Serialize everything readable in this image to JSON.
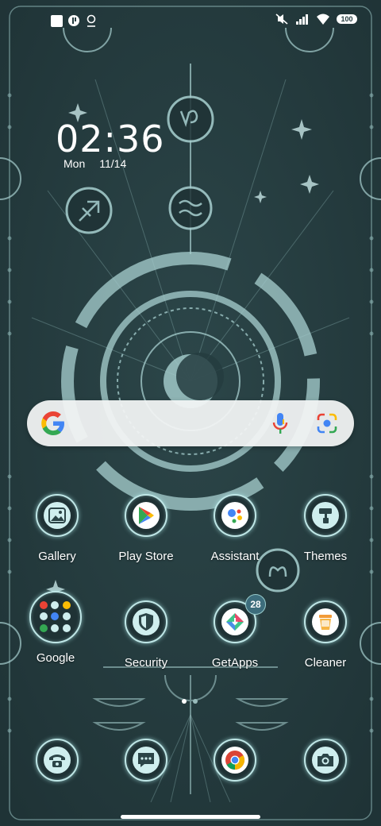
{
  "status_bar": {
    "left_icons": [
      "square-icon",
      "app-notification-icon",
      "gallery-notification-icon"
    ],
    "right_icons": [
      "mute-icon",
      "signal-icon",
      "wifi-icon"
    ],
    "battery": "100"
  },
  "clock": {
    "time": "02:36",
    "day": "Mon",
    "date": "11/14"
  },
  "search": {
    "icons": [
      "google-g-icon",
      "mic-icon",
      "lens-icon"
    ]
  },
  "apps_row1": [
    {
      "label": "Gallery",
      "icon": "gallery-icon"
    },
    {
      "label": "Play Store",
      "icon": "play-store-icon"
    },
    {
      "label": "Assistant",
      "icon": "assistant-icon"
    },
    {
      "label": "Themes",
      "icon": "themes-icon"
    }
  ],
  "apps_row2": [
    {
      "label": "Google",
      "icon": "folder-icon"
    },
    {
      "label": "Security",
      "icon": "security-icon"
    },
    {
      "label": "GetApps",
      "icon": "getapps-icon",
      "badge": "28"
    },
    {
      "label": "Cleaner",
      "icon": "cleaner-icon"
    }
  ],
  "dock": [
    {
      "icon": "phone-icon"
    },
    {
      "icon": "messages-icon"
    },
    {
      "icon": "chrome-icon"
    },
    {
      "icon": "camera-icon"
    }
  ],
  "page_indicator": {
    "pages": 2,
    "current": 1
  },
  "colors": {
    "background": "#253c3f",
    "accent": "#bfe6e6"
  }
}
